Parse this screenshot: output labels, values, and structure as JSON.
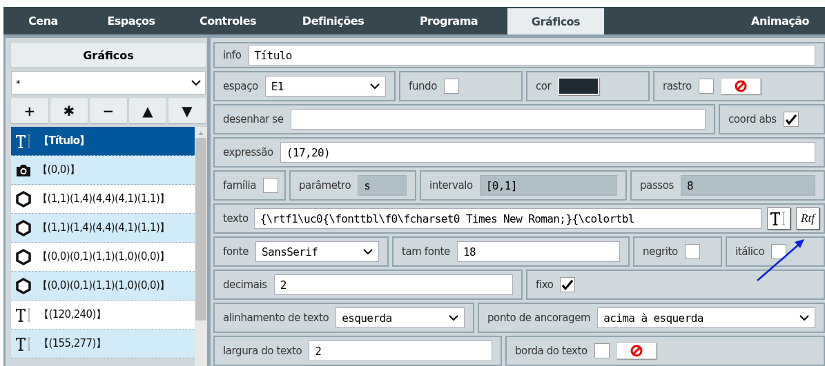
{
  "tabs": [
    {
      "label": "Cena",
      "selected": false
    },
    {
      "label": "Espaços",
      "selected": false
    },
    {
      "label": "Controles",
      "selected": false
    },
    {
      "label": "Definições",
      "selected": false
    },
    {
      "label": "Programa",
      "selected": false
    },
    {
      "label": "Gráficos",
      "selected": true
    },
    {
      "label": "Animação",
      "selected": false
    }
  ],
  "sidebar": {
    "title": "Gráficos",
    "filter": {
      "value": "*"
    },
    "toolbar": [
      "+",
      "✱",
      "−",
      "▲",
      "▼"
    ],
    "items": [
      {
        "kind": "text",
        "label": "【Título】",
        "selected": true
      },
      {
        "kind": "camera",
        "label": "【(0,0)】",
        "selected": false
      },
      {
        "kind": "polygon",
        "label": "【(1,1)(1,4)(4,4)(4,1)(1,1)】",
        "selected": false
      },
      {
        "kind": "polygon",
        "label": "【(1,1)(1,4)(4,4)(4,1)(1,1)】",
        "selected": false
      },
      {
        "kind": "polygon",
        "label": "【(0,0)(0,1)(1,1)(1,0)(0,0)】",
        "selected": false
      },
      {
        "kind": "polygon",
        "label": "【(0,0)(0,1)(1,1)(1,0)(0,0)】",
        "selected": false
      },
      {
        "kind": "text",
        "label": "【(120,240)】",
        "selected": false
      },
      {
        "kind": "text",
        "label": "【(155,277)】",
        "selected": false
      }
    ]
  },
  "form": [
    [
      {
        "kind": "input",
        "label": "info",
        "value": "Título"
      }
    ],
    [
      {
        "kind": "select",
        "label": "espaço",
        "value": "E1"
      },
      {
        "kind": "checkbox",
        "label": "fundo",
        "checked": false
      },
      {
        "kind": "color",
        "label": "cor",
        "color": "#1f2b33"
      },
      {
        "kind": "trace",
        "label": "rastro",
        "checked": false
      }
    ],
    [
      {
        "kind": "input",
        "label": "desenhar se"
      },
      {
        "kind": "checkbox",
        "label": "coord abs",
        "checked": true
      }
    ],
    [
      {
        "kind": "input",
        "label": "expressão",
        "value": "(17,20)"
      }
    ],
    [
      {
        "kind": "checkbox",
        "label": "família",
        "checked": false
      },
      {
        "kind": "readonly",
        "label": "parâmetro",
        "value": "s"
      },
      {
        "kind": "readonly",
        "label": "intervalo",
        "value": "[0,1]"
      },
      {
        "kind": "readonly",
        "label": "passos",
        "value": "8"
      }
    ],
    [
      {
        "kind": "editor",
        "label": "texto",
        "value": "{\\rtf1\\uc0{\\fonttbl\\f0\\fcharset0 Times New Roman;}{\\colortbl",
        "rtf_button": "Rtf"
      }
    ],
    [
      {
        "kind": "select",
        "label": "fonte",
        "value": "SansSerif"
      },
      {
        "kind": "input",
        "label": "tam fonte",
        "value": "18"
      },
      {
        "kind": "checkbox",
        "label": "negrito",
        "checked": false
      },
      {
        "kind": "checkbox",
        "label": "itálico",
        "checked": false
      }
    ],
    [
      {
        "kind": "input",
        "label": "decimais",
        "value": "2"
      },
      {
        "kind": "checkbox",
        "label": "fixo",
        "checked": true
      }
    ],
    [
      {
        "kind": "select",
        "label": "alinhamento de texto",
        "value": "esquerda"
      },
      {
        "kind": "select",
        "label": "ponto de ancoragem",
        "value": "acima à esquerda"
      }
    ],
    [
      {
        "kind": "input",
        "label": "largura do texto",
        "value": "2"
      },
      {
        "kind": "trace",
        "label": "borda do texto",
        "checked": false
      }
    ]
  ]
}
